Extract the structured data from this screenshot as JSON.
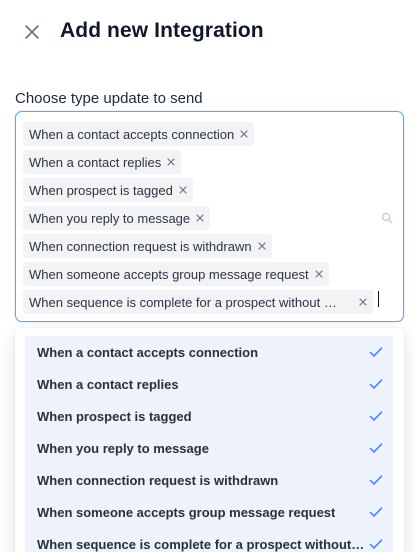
{
  "header": {
    "title": "Add new Integration"
  },
  "field": {
    "label": "Choose type update to send"
  },
  "selected_chips": [
    "When a contact accepts connection",
    "When a contact replies",
    "When prospect is tagged",
    "When you reply to message",
    "When connection request is withdrawn",
    "When someone accepts group message request",
    "When sequence is complete for a prospect without …"
  ],
  "dropdown_options": [
    "When a contact accepts connection",
    "When a contact replies",
    "When prospect is tagged",
    "When you reply to message",
    "When connection request is withdrawn",
    "When someone accepts group message request",
    "When sequence is complete for a prospect without …"
  ],
  "colors": {
    "accent": "#60a5fa",
    "check": "#3b82f6",
    "chip_bg": "#f2f3f5",
    "option_selected_bg": "#eef2fd"
  }
}
